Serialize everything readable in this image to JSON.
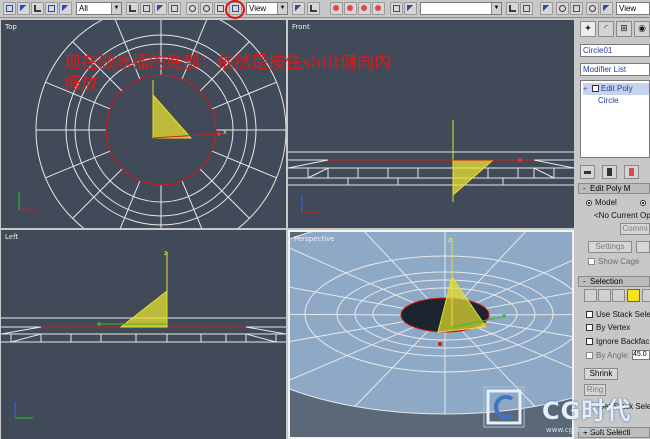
{
  "toolbar": {
    "selection_filter": "All",
    "reference_coord": "View",
    "named_selection": ""
  },
  "viewports": {
    "top": "Top",
    "front": "Front",
    "left": "Left",
    "perspective": "Perspective"
  },
  "annotation": {
    "line1": "现在做冰插的底部：依然是按住shift健向内",
    "line2": "缩放"
  },
  "command_panel": {
    "object_name": "Circle01",
    "modifier_list": "Modifier List",
    "stack_items": [
      "Edit Poly",
      "Circle"
    ],
    "rollouts": {
      "edit_poly_mode": "Edit Poly M",
      "selection": "Selection",
      "soft_selection": "Soft Selecti"
    },
    "mode_options": [
      "Model",
      ""
    ],
    "no_current_op": "<No Current Op",
    "commit_label": "Commi",
    "settings_label": "Settings",
    "show_cage": "Show Cage",
    "selection_options": {
      "use_stack_selection": "Use Stack Sele",
      "by_vertex": "By Vertex",
      "ignore_backfacing": "Ignore Backfac",
      "by_angle": "By Angle:",
      "angle_value": "45.0"
    },
    "shrink_label": "Shrink",
    "ring_label": "Ring",
    "get_stack_selection": "Get Stack Sele"
  },
  "watermark": {
    "brand": "CG时代",
    "url": "www.cgtimo.com.cn"
  },
  "colors": {
    "viewport_bg": "#404a58",
    "perspective_bg": "#5a6878",
    "annotation_red": "#e01818",
    "wire": "#e8e8e8",
    "selected_circle": "#d81818",
    "cone_yellow": "#e8e030",
    "disk_fill": "#8ea9c6",
    "modifier_blue": "#1d3d9c"
  }
}
